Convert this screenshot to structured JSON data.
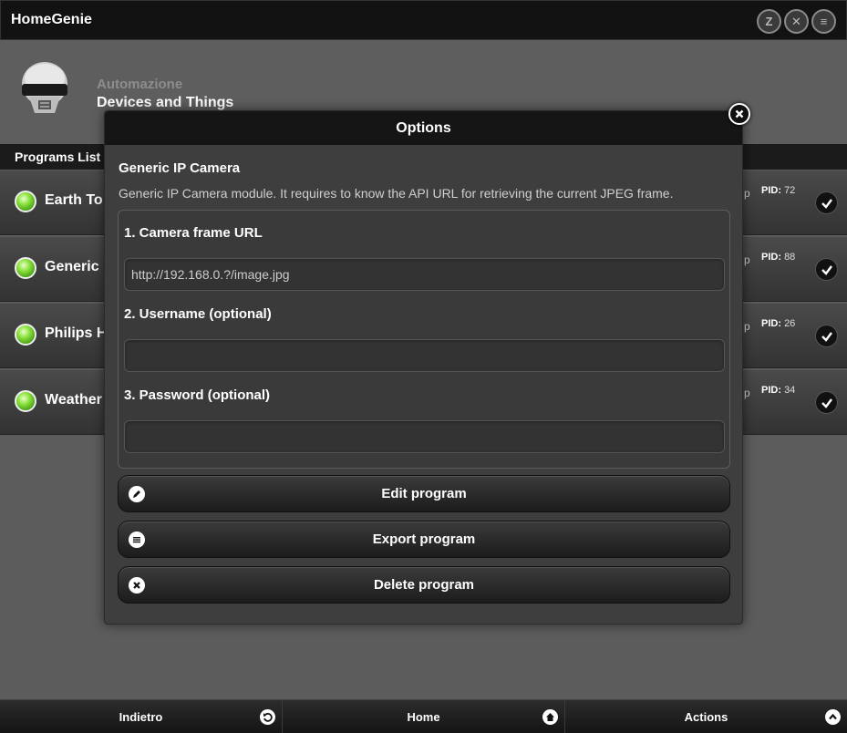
{
  "app": {
    "title": "HomeGenie"
  },
  "top_icons": [
    "z-wave-icon",
    "x10-icon",
    "filter-icon"
  ],
  "group": {
    "category": "Automazione",
    "title": "Devices and Things"
  },
  "list": {
    "header": "Programs List",
    "rows": [
      {
        "name": "Earth To",
        "type_fragment": "p",
        "pid_label": "PID:",
        "pid": "72"
      },
      {
        "name": "Generic",
        "type_fragment": "p",
        "pid_label": "PID:",
        "pid": "88"
      },
      {
        "name": "Philips H",
        "type_fragment": "p",
        "pid_label": "PID:",
        "pid": "26"
      },
      {
        "name": "Weather",
        "type_fragment": "p",
        "pid_label": "PID:",
        "pid": "34"
      }
    ]
  },
  "dialog": {
    "title": "Options",
    "module_title": "Generic IP Camera",
    "module_desc": "Generic IP Camera module. It requires to know the API URL for retrieving the current JPEG frame.",
    "fields": [
      {
        "label": "1. Camera frame URL",
        "value": "http://192.168.0.?/image.jpg"
      },
      {
        "label": "2. Username (optional)",
        "value": ""
      },
      {
        "label": "3. Password (optional)",
        "value": ""
      }
    ],
    "buttons": {
      "edit": "Edit program",
      "export": "Export program",
      "delete": "Delete program"
    }
  },
  "footer": {
    "back": "Indietro",
    "home": "Home",
    "actions": "Actions"
  },
  "colors": {
    "background": "#5c5c5c",
    "bar": "#121212",
    "led_green": "#8fe340"
  }
}
